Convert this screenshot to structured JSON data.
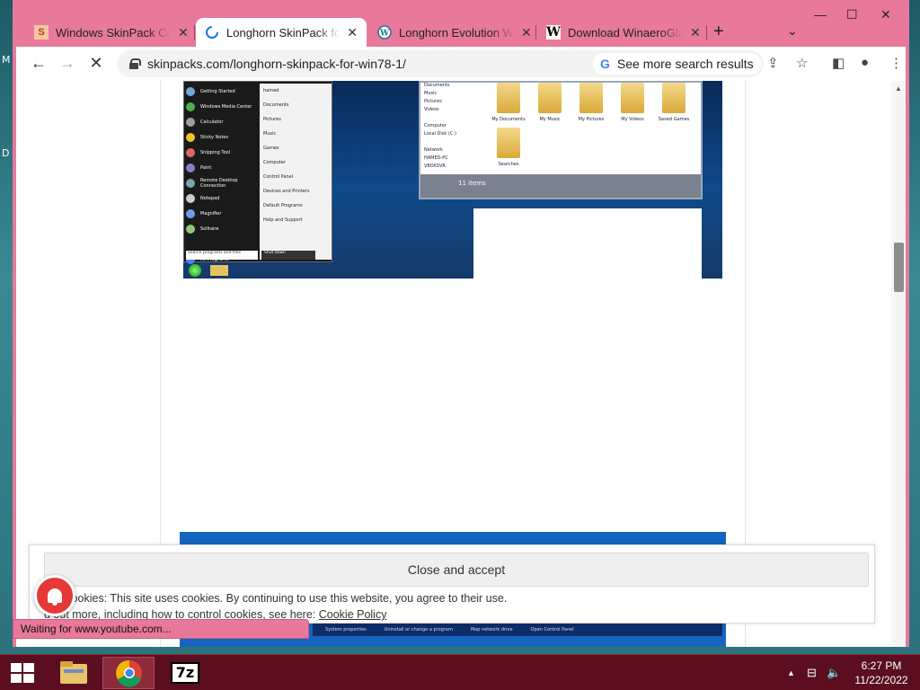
{
  "desktop": {
    "letter_m": "M",
    "letter_d": "D"
  },
  "browser": {
    "tabs": [
      {
        "title": "Windows SkinPack Colle",
        "icon": "skinpack-favicon",
        "active": false
      },
      {
        "title": "Longhorn SkinPack for",
        "icon": "loading-spinner-icon",
        "active": true
      },
      {
        "title": "Longhorn Evolution W",
        "icon": "wordpress-favicon",
        "active": false
      },
      {
        "title": "Download WinaeroGlas",
        "icon": "winaero-favicon",
        "active": false
      }
    ],
    "close_glyph": "✕",
    "new_tab_glyph": "+",
    "tab_search_glyph": "⌄",
    "window_controls": {
      "minimize": "—",
      "maximize": "☐",
      "close": "✕"
    },
    "url": "skinpacks.com/longhorn-skinpack-for-win78-1/",
    "search_chip": "See more search results",
    "search_chip_logo": "G",
    "nav": {
      "back": "←",
      "forward": "→",
      "stop": "✕"
    },
    "tools": {
      "share": "⇪",
      "star": "☆",
      "sidebar": "◧",
      "profile": "●",
      "menu": "⋮"
    },
    "status": "Waiting for www.youtube.com...",
    "accent_color": "#e8799a"
  },
  "article": {
    "start_menu_left": [
      "Getting Started",
      "Windows Media Center",
      "Calculator",
      "Sticky Notes",
      "Snipping Tool",
      "Paint",
      "Remote Desktop Connection",
      "Notepad",
      "Magnifier",
      "Solitaire",
      "",
      "All Programs"
    ],
    "start_menu_right": [
      "hamed",
      "Documents",
      "Pictures",
      "Music",
      "Games",
      "Computer",
      "Control Panel",
      "Devices and Printers",
      "Default Programs",
      "Help and Support"
    ],
    "search_box": "Search programs and files",
    "shut_down": "Shut down",
    "explorer_nav": [
      "Documents",
      "Music",
      "Pictures",
      "Videos",
      "",
      "Computer",
      "Local Disk (C:)",
      "",
      "Network",
      "HAMED-PC",
      "VBOXSVR"
    ],
    "explorer_folders": [
      "My Documents",
      "My Music",
      "My Pictures",
      "My Videos",
      "Saved Games",
      "Searches"
    ],
    "item_count": "11 items",
    "bottom_strip": [
      "System properties",
      "Uninstall or change a program",
      "Map network drive",
      "Open Control Panel"
    ]
  },
  "cookie": {
    "button": "Close and accept",
    "text": "y & Cookies: This site uses cookies. By continuing to use this website, you agree to their use.",
    "text2_prefix": "d out more, including how to control cookies, see here: ",
    "link": "Cookie Policy"
  },
  "taskbar": {
    "time": "6:27 PM",
    "date": "11/22/2022",
    "sevenzip_label": "7z",
    "tray_up": "▲",
    "tray_network": "⊟",
    "tray_volume": "🔈"
  }
}
